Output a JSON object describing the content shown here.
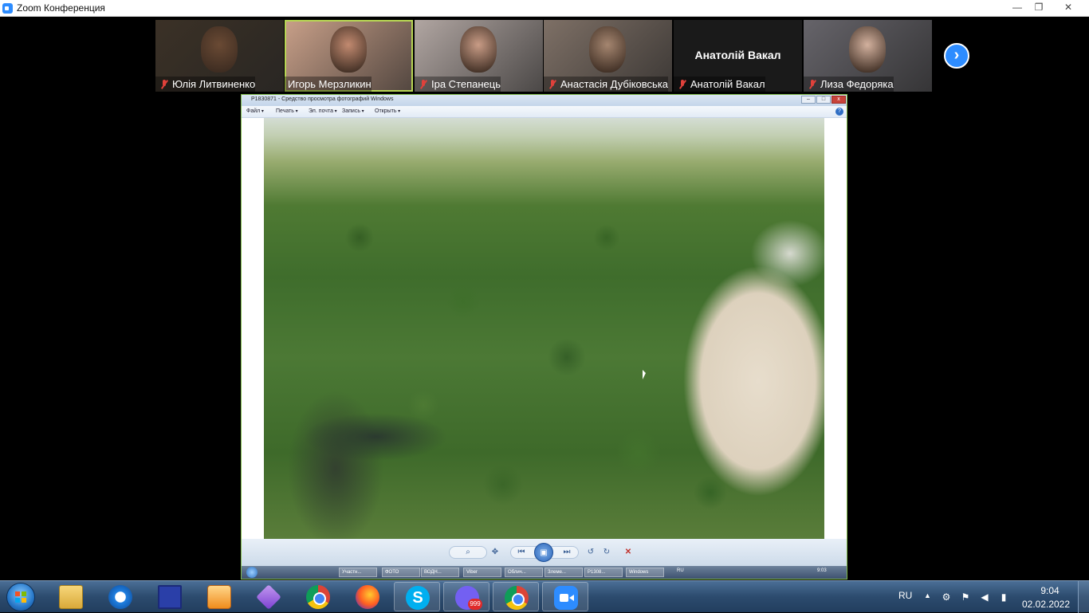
{
  "window": {
    "title": "Zoom Конференция",
    "min": "—",
    "max": "❐",
    "close": "✕"
  },
  "participants": [
    {
      "name": "Юлія Литвиненко",
      "muted": true,
      "video": true,
      "bg": "#3b3126",
      "face": "#6a4a34"
    },
    {
      "name": "Игорь Мерзликин",
      "muted": false,
      "video": true,
      "active": true,
      "bg": "#c9a089",
      "face": "#c28a70"
    },
    {
      "name": "Іра Степанець",
      "muted": true,
      "video": true,
      "bg": "#b1a6a2",
      "face": "#c99c86"
    },
    {
      "name": "Анастасія Дубіковська",
      "muted": true,
      "video": true,
      "bg": "#7e7066",
      "face": "#a58670"
    },
    {
      "name": "Анатолій Вакал",
      "muted": true,
      "video": false,
      "bg": "#1a1a1a",
      "face": ""
    },
    {
      "name": "Лиза Федоряка",
      "muted": true,
      "video": true,
      "bg": "#66646a",
      "face": "#d3b19e"
    }
  ],
  "no_video_label": "Анатолій Вакал",
  "next_page": "›",
  "photo_viewer": {
    "title": "P1830871 - Средство просмотра фотографий Windows",
    "min": "–",
    "max": "□",
    "close": "x",
    "menu": [
      "Файл",
      "Печать",
      "Эл. почта",
      "Запись",
      "Открыть"
    ],
    "help": "?",
    "controls": {
      "zoom": "⌕",
      "fit": "✥",
      "prev": "⏮",
      "play": "▣",
      "next": "⏭",
      "rotate_left": "↺",
      "rotate_right": "↻",
      "delete": "✕"
    }
  },
  "remote_taskbar": {
    "buttons": [
      "Участн...",
      "ФОТО",
      "ВОДН...",
      "Viber",
      "Облич...",
      "Злеме...",
      "P1308...",
      "Windows"
    ],
    "lang": "RU",
    "clock": "9:03"
  },
  "taskbar": {
    "apps": [
      {
        "name": "explorer",
        "running": false
      },
      {
        "name": "ie",
        "running": false
      },
      {
        "name": "save",
        "running": false
      },
      {
        "name": "player",
        "running": false
      },
      {
        "name": "pen",
        "running": false
      },
      {
        "name": "chrome",
        "running": false
      },
      {
        "name": "firefox",
        "running": false
      },
      {
        "name": "skype",
        "running": true,
        "glyph": "S"
      },
      {
        "name": "viber",
        "running": true,
        "badge": "999"
      },
      {
        "name": "chrome",
        "running": true
      },
      {
        "name": "zoom",
        "running": true
      }
    ],
    "lang": "RU",
    "tray_up": "▲",
    "clock_time": "9:04",
    "clock_date": "02.02.2022"
  }
}
